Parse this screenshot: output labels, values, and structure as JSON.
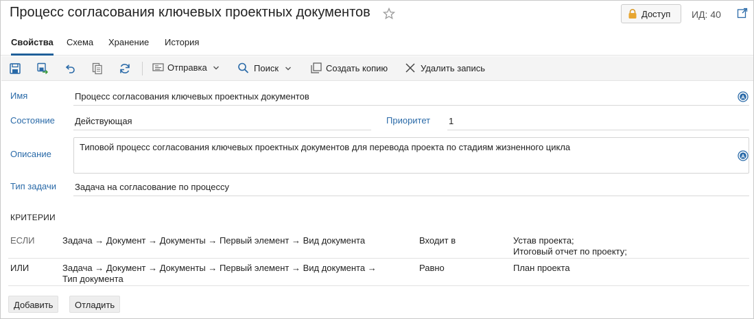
{
  "header": {
    "title": "Процесс согласования ключевых проектных документов",
    "access_label": "Доступ",
    "id_label": "ИД: 40"
  },
  "tabs": [
    {
      "label": "Свойства",
      "active": true
    },
    {
      "label": "Схема",
      "active": false
    },
    {
      "label": "Хранение",
      "active": false
    },
    {
      "label": "История",
      "active": false
    }
  ],
  "toolbar": {
    "send_label": "Отправка",
    "search_label": "Поиск",
    "copy_label": "Создать копию",
    "delete_label": "Удалить запись"
  },
  "form": {
    "name_label": "Имя",
    "name_value": "Процесс согласования ключевых проектных документов",
    "state_label": "Состояние",
    "state_value": "Действующая",
    "priority_label": "Приоритет",
    "priority_value": "1",
    "description_label": "Описание",
    "description_value": "Типовой процесс согласования ключевых проектных документов для перевода проекта по стадиям жизненного цикла",
    "task_type_label": "Тип задачи",
    "task_type_value": "Задача на согласование по процессу"
  },
  "criteria": {
    "title": "КРИТЕРИИ",
    "rows": [
      {
        "prefix": "ЕСЛИ",
        "path": "Задача → Документ → Документы → Первый элемент → Вид документа",
        "operator": "Входит в",
        "value_line1": "Устав проекта;",
        "value_line2": "Итоговый отчет по проекту;"
      },
      {
        "prefix": "ИЛИ",
        "path_line1": "Задача → Документ → Документы → Первый элемент → Вид документа →",
        "path_line2": "Тип документа",
        "operator": "Равно",
        "value": "План проекта"
      }
    ]
  },
  "actions": {
    "add_label": "Добавить",
    "debug_label": "Отладить"
  },
  "colors": {
    "label_blue": "#2a6aa8",
    "tab_accent": "#1f5f99",
    "icon_blue": "#2a6aa8"
  }
}
